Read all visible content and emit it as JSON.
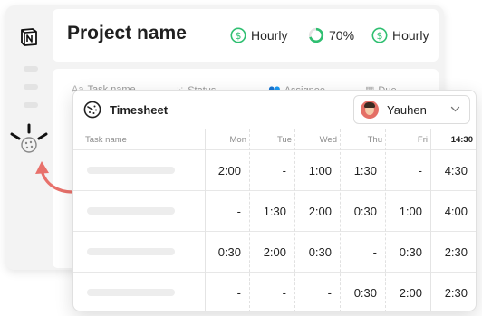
{
  "project": {
    "title": "Project name",
    "metrics": [
      {
        "icon": "dollar-icon",
        "label": "Hourly"
      },
      {
        "icon": "progress-ring-icon",
        "label": "70%",
        "progress": 0.7
      },
      {
        "icon": "dollar-icon",
        "label": "Hourly"
      }
    ]
  },
  "background_table": {
    "columns": [
      {
        "icon": "Aa",
        "label": "Task name"
      },
      {
        "icon": "status-icon",
        "label": "Status"
      },
      {
        "icon": "people-icon",
        "label": "Assignee"
      },
      {
        "icon": "calendar-icon",
        "label": "Due"
      }
    ]
  },
  "timesheet": {
    "title": "Timesheet",
    "user": "Yauhen",
    "columns": [
      "Task name",
      "Mon",
      "Tue",
      "Wed",
      "Thu",
      "Fri",
      "14:30"
    ],
    "rows": [
      {
        "mon": "2:00",
        "tue": "-",
        "wed": "1:00",
        "thu": "1:30",
        "fri": "-",
        "total": "4:30"
      },
      {
        "mon": "-",
        "tue": "1:30",
        "wed": "2:00",
        "thu": "0:30",
        "fri": "1:00",
        "total": "4:00"
      },
      {
        "mon": "0:30",
        "tue": "2:00",
        "wed": "0:30",
        "thu": "-",
        "fri": "0:30",
        "total": "2:30"
      },
      {
        "mon": "-",
        "tue": "-",
        "wed": "-",
        "thu": "0:30",
        "fri": "2:00",
        "total": "2:30"
      }
    ]
  },
  "colors": {
    "accent_green": "#2fbf71",
    "arrow_red": "#e8716b"
  }
}
